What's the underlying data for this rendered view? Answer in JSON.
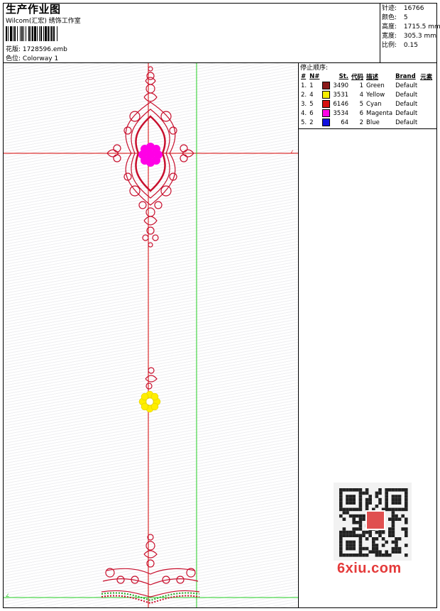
{
  "header": {
    "title": "生产作业图",
    "subtitle": "Wilcom(汇宏) 绣饰工作室",
    "design_label": "花版:",
    "design_value": "1728596.emb",
    "colorway_label": "色位:",
    "colorway_value": "Colorway 1"
  },
  "stats": [
    {
      "label": "针迹:",
      "value": "16766"
    },
    {
      "label": "颜色:",
      "value": "5"
    },
    {
      "label": "高度:",
      "value": "1715.5 mm"
    },
    {
      "label": "宽度:",
      "value": "305.3 mm"
    },
    {
      "label": "比例:",
      "value": "0.15"
    }
  ],
  "stop_sequence": {
    "title": "停止顺序:",
    "headers": [
      "#",
      "N#",
      "St.",
      "代码",
      "描述",
      "Brand",
      "元素"
    ],
    "rows": [
      {
        "idx": "1.",
        "n": "1",
        "color": "#8b1a1a",
        "st": "3490",
        "code": "1",
        "desc": "Green",
        "brand": "Default"
      },
      {
        "idx": "2.",
        "n": "4",
        "color": "#f5ee00",
        "st": "3531",
        "code": "4",
        "desc": "Yellow",
        "brand": "Default"
      },
      {
        "idx": "3.",
        "n": "5",
        "color": "#d81010",
        "st": "6146",
        "code": "5",
        "desc": "Cyan",
        "brand": "Default"
      },
      {
        "idx": "4.",
        "n": "6",
        "color": "#ff00e6",
        "st": "3534",
        "code": "6",
        "desc": "Magenta",
        "brand": "Default"
      },
      {
        "idx": "5.",
        "n": "2",
        "color": "#1010e0",
        "st": "64",
        "code": "2",
        "desc": "Blue",
        "brand": "Default"
      }
    ]
  },
  "watermark": "6xiu.com",
  "colors": {
    "guide_red": "#d40000",
    "guide_green": "#22cc22",
    "embroidery_red": "#c8102e",
    "flower_magenta": "#ff00e6",
    "flower_yellow": "#ffee00"
  }
}
